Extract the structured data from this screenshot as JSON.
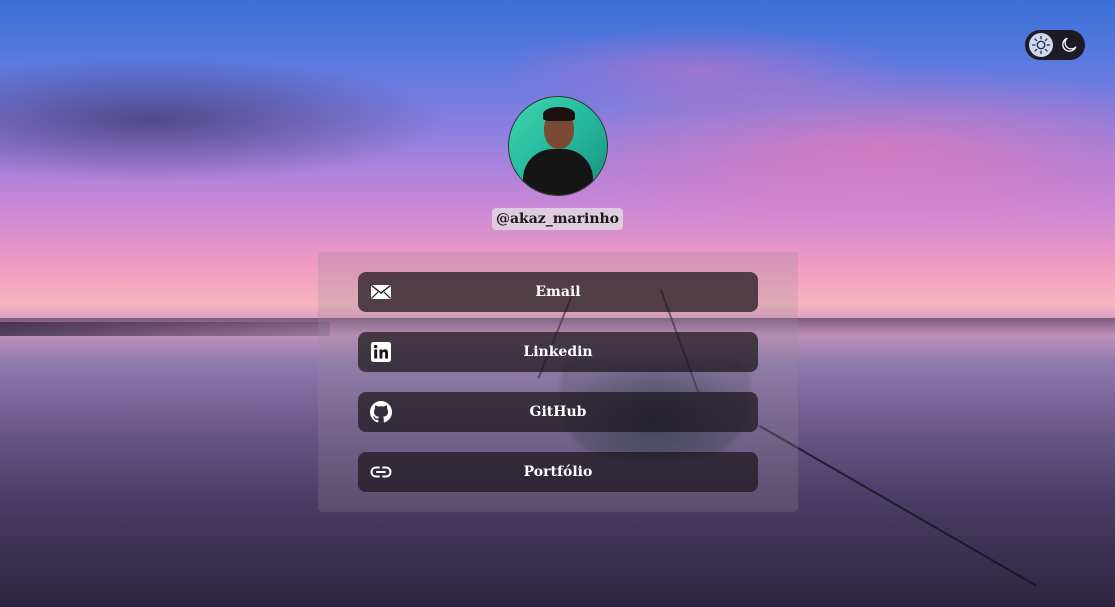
{
  "profile": {
    "username": "@akaz_marinho"
  },
  "theme_toggle": {
    "light_icon": "sun-icon",
    "dark_icon": "moon-icon"
  },
  "links": [
    {
      "label": "Email",
      "icon": "envelope-icon"
    },
    {
      "label": "Linkedin",
      "icon": "linkedin-icon"
    },
    {
      "label": "GitHub",
      "icon": "github-icon"
    },
    {
      "label": "Portfólio",
      "icon": "link-icon"
    }
  ],
  "colors": {
    "button_bg": "#1c161c",
    "button_text": "#ffffff",
    "avatar_bg": "#2fc7a6",
    "toggle_bg": "#1f1b26"
  }
}
